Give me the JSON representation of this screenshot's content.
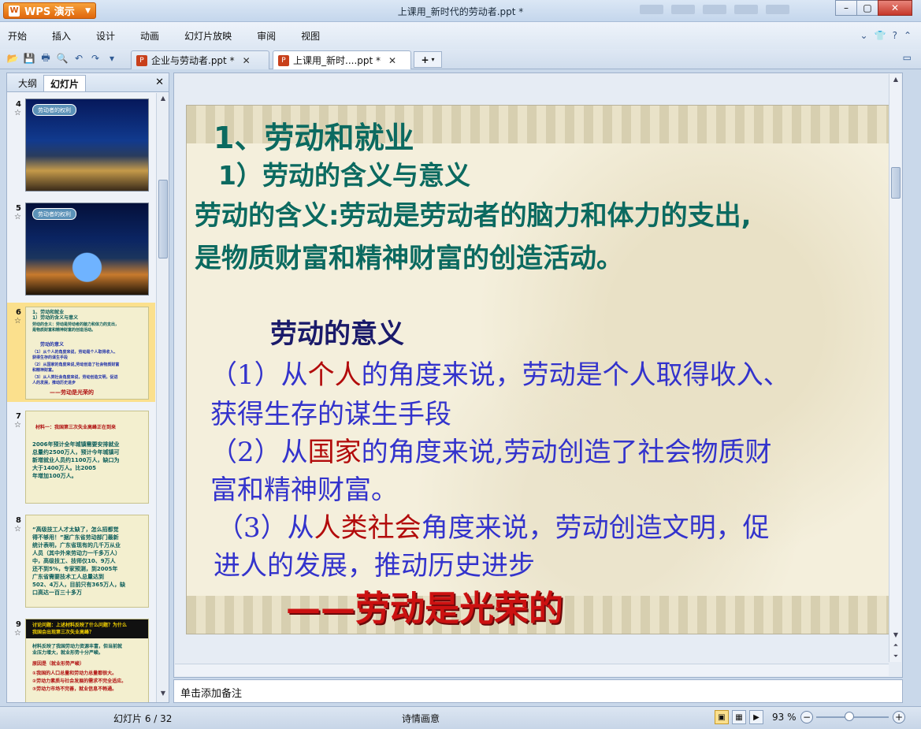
{
  "app": {
    "name": "WPS 演示",
    "window_title": "上课用_新时代的劳动者.ppt *"
  },
  "menu": [
    "开始",
    "插入",
    "设计",
    "动画",
    "幻灯片放映",
    "审阅",
    "视图"
  ],
  "tabs": [
    {
      "label": "企业与劳动者.ppt *"
    },
    {
      "label": "上课用_新时....ppt *"
    }
  ],
  "left_panel": {
    "tabs": [
      "大纲",
      "幻灯片"
    ],
    "slides": [
      {
        "num": "4",
        "badge": "劳动者的权利"
      },
      {
        "num": "5",
        "badge": "劳动者的权利"
      },
      {
        "num": "6",
        "lines": [
          "1、劳动和就业",
          "1）劳动的含义与意义",
          "劳动的含义：劳动是劳动者的脑力和体力的支出，",
          "是物质财富和精神财富的创造活动。",
          "劳动的意义",
          "（1）从个人的角度来说，劳动是个人取得收入、",
          "获得生存的谋生手段",
          "（2）从国家的角度来说,劳动创造了社会物质财富",
          "和精神财富。",
          "（3）从人类社会角度来说，劳动创造文明，促进",
          "人的发展，推动历史进步",
          "——劳动是光荣的"
        ]
      },
      {
        "num": "7",
        "lines": [
          "材料一：我国第三次失业高峰正在到来",
          "2006年预计全年城镇需要安排就业",
          "总量约2500万人，预计今年城镇可",
          "新增就业人员约1100万人，缺口为",
          "大于1400万人。比2005",
          "年增加100万人。"
        ]
      },
      {
        "num": "8",
        "lines": [
          "“高级技工人才太缺了，怎么招都觉",
          "得不够用！”据广东省劳动部门最新",
          "统计表明，广东省现有的几千万从业",
          "人员（其中外来劳动力一千多万人）",
          "中，高级技工、技师仅10、9万人",
          "还不到5%，专家预测，到2005年",
          "广东省需要技术工人总量达到",
          "502、4万人，目前只有365万人，缺",
          "口高达一百三十多万"
        ]
      },
      {
        "num": "9",
        "lines": [
          "讨论问题：上述材料反映了什么问题？为什么",
          "我国会出现第三次失业高峰？",
          "材料反映了我国劳动力资源丰富，但当前就",
          "业压力增大，就业形势十分严峻。",
          "原因是（就业形势严峻）",
          "①我国的人口总量和劳动力总量都很大。",
          "②劳动力素质与社会发展的需求不完全适应。",
          "③劳动力市场不完善，就业信息不畅通。"
        ]
      }
    ]
  },
  "slide": {
    "heading1": "1、劳动和就业",
    "heading2": "1）劳动的含义与意义",
    "definition_line1": "劳动的含义:劳动是劳动者的脑力和体力的支出,",
    "definition_line2": "是物质财富和精神财富的创造活动。",
    "significance_title": "劳动的意义",
    "p1a_prefix": "（1）从",
    "p1a_hl": "个人",
    "p1a_suffix": "的角度来说，劳动是个人取得收入、",
    "p1b": "获得生存的谋生手段",
    "p2a_prefix": "（2）从",
    "p2a_hl": "国家",
    "p2a_suffix": "的角度来说,劳动创造了社会物质财",
    "p2b": "富和精神财富。",
    "p3a_prefix": "（3）从",
    "p3a_hl": "人类社会",
    "p3a_suffix": "角度来说，劳动创造文明，促",
    "p3b": "进人的发展，推动历史进步",
    "conclusion": "——劳动是光荣的"
  },
  "notes_placeholder": "单击添加备注",
  "status": {
    "slide_counter": "幻灯片 6 / 32",
    "theme": "诗情画意",
    "zoom": "93 %"
  }
}
